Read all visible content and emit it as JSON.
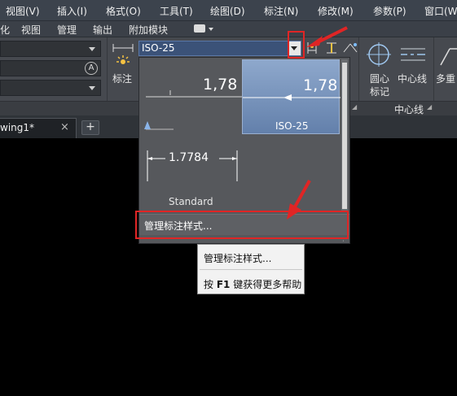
{
  "menu": {
    "items": [
      "视图(V)",
      "插入(I)",
      "格式(O)",
      "工具(T)",
      "绘图(D)",
      "标注(N)",
      "修改(M)",
      "参数(P)",
      "窗口(W"
    ]
  },
  "ribbon_tabs": {
    "items": [
      "化",
      "视图",
      "管理",
      "输出",
      "附加模块"
    ]
  },
  "ribbon": {
    "dim_button_label": "标注",
    "style_combo_value": "ISO-25",
    "center_mark_label_1": "圆心",
    "center_mark_label_2": "标记",
    "centerline_label": "中心线",
    "multileader_label": "多重",
    "centerline_panel_title": "中心线"
  },
  "doc_tab": {
    "name": "wing1*",
    "close": "×",
    "add": "+"
  },
  "style_popup": {
    "preview_value_1": "1,78",
    "preview_value_2": "1,78",
    "selected_style": "ISO-25",
    "standard_value": "1.7784",
    "standard_name": "Standard",
    "manage_label": "管理标注样式..."
  },
  "context_menu": {
    "item1": "管理标注样式...",
    "item2_prefix": "按 ",
    "item2_key": "F1",
    "item2_suffix": " 键获得更多帮助"
  },
  "colors": {
    "menubar_bg": "#3c434d",
    "ribbon_bg": "#46494f",
    "popup_bg": "#56585c",
    "selected_bg": "#6b87b4",
    "highlight_red": "#e02525",
    "canvas_bg": "#000000"
  }
}
